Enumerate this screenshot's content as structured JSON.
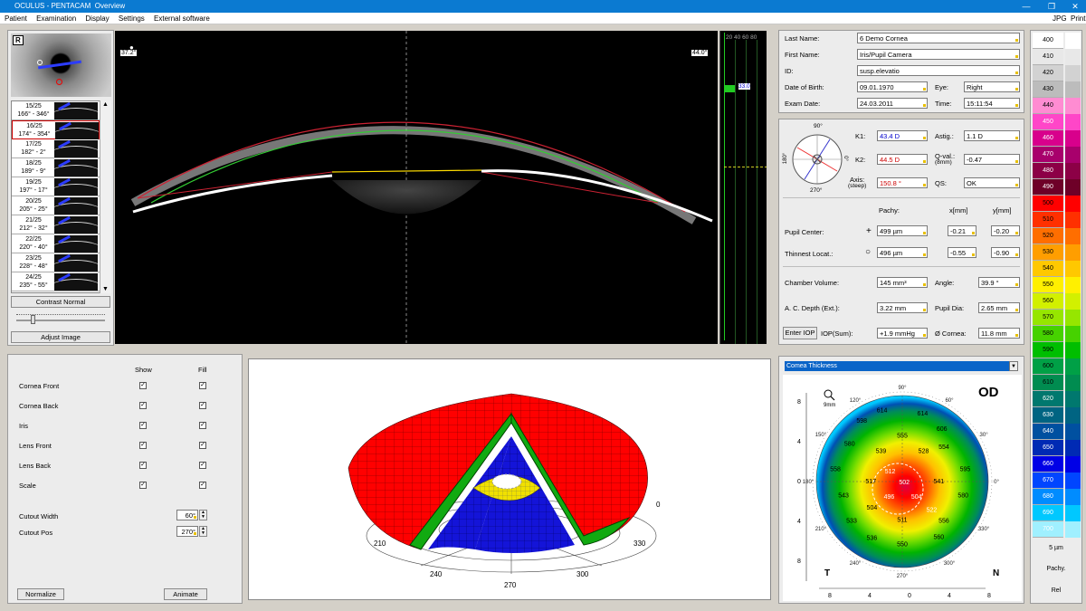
{
  "window": {
    "app": "OCULUS - PENTACAM",
    "view": "Overview"
  },
  "menu": [
    "Patient",
    "Examination",
    "Display",
    "Settings",
    "External software"
  ],
  "menu_right": [
    "JPG",
    "Print"
  ],
  "eye_image": {
    "label": "R"
  },
  "scans": [
    {
      "n": "15/25",
      "deg": "166° - 346°"
    },
    {
      "n": "16/25",
      "deg": "174° - 354°"
    },
    {
      "n": "17/25",
      "deg": "182° - 2°"
    },
    {
      "n": "18/25",
      "deg": "189° - 9°"
    },
    {
      "n": "19/25",
      "deg": "197° - 17°"
    },
    {
      "n": "20/25",
      "deg": "205° - 25°"
    },
    {
      "n": "21/25",
      "deg": "212° - 32°"
    },
    {
      "n": "22/25",
      "deg": "220° - 40°"
    },
    {
      "n": "23/25",
      "deg": "228° - 48°"
    },
    {
      "n": "24/25",
      "deg": "235° - 55°"
    }
  ],
  "scan_controls": {
    "contrast": "Contrast Normal",
    "adjust": "Adjust Image"
  },
  "scheimpflug": {
    "angle_left": "37.2°",
    "angle_right": "44.0°",
    "densito_ticks": "20 40 60 80",
    "densito_value": "33.0"
  },
  "patient": {
    "last_name_label": "Last Name:",
    "last_name": "6 Demo Cornea",
    "first_name_label": "First Name:",
    "first_name": "Iris/Pupil Camera",
    "id_label": "ID:",
    "id": "susp.elevatio",
    "dob_label": "Date of Birth:",
    "dob": "09.01.1970",
    "eye_label": "Eye:",
    "eye": "Right",
    "exam_label": "Exam Date:",
    "exam": "24.03.2011",
    "time_label": "Time:",
    "time": "15:11:54"
  },
  "kerato": {
    "k1_label": "K1:",
    "k1": "43.4 D",
    "k2_label": "K2:",
    "k2": "44.5 D",
    "axis_label": "Axis:",
    "axis_sub": "(steep)",
    "axis": "150.8 °",
    "astig_label": "Astig.:",
    "astig": "1.1 D",
    "qval_label": "Q-val.:",
    "qval_sub": "(8mm)",
    "qval": "-0.47",
    "qs_label": "QS:",
    "qs": "OK",
    "dial_top": "90°",
    "dial_bottom": "270°",
    "dial_left": "180°",
    "dial_right": "0°"
  },
  "measure": {
    "pachy_hdr": "Pachy:",
    "x_hdr": "x[mm]",
    "y_hdr": "y[mm]",
    "pupil_label": "Pupil Center:",
    "pupil_pachy": "499 µm",
    "pupil_x": "-0.21",
    "pupil_y": "-0.20",
    "thin_label": "Thinnest Locat.:",
    "thin_pachy": "496 µm",
    "thin_x": "-0.55",
    "thin_y": "-0.90",
    "cv_label": "Chamber Volume:",
    "cv": "145 mm³",
    "angle_label": "Angle:",
    "angle": "39.9 °",
    "acd_label": "A. C. Depth (Ext.):",
    "acd": "3.22 mm",
    "pd_label": "Pupil Dia:",
    "pd": "2.65 mm",
    "iop_btn": "Enter IOP",
    "iop_label": "IOP(Sum):",
    "iop": "+1.9 mmHg",
    "cornea_label": "Ø Cornea:",
    "cornea": "11.8 mm"
  },
  "display_opts": {
    "show_hdr": "Show",
    "fill_hdr": "Fill",
    "rows": [
      "Cornea Front",
      "Cornea Back",
      "Iris",
      "Lens Front",
      "Lens Back",
      "Scale"
    ],
    "cutout_width_label": "Cutout Width",
    "cutout_width": "60°",
    "cutout_pos_label": "Cutout Pos",
    "cutout_pos": "270°",
    "normalize": "Normalize",
    "animate": "Animate"
  },
  "model3d": {
    "angle_labels": [
      "0",
      "330",
      "300",
      "270",
      "240",
      "210"
    ]
  },
  "map": {
    "dropdown": "Comea Thickness",
    "eye": "OD",
    "temporal": "T",
    "nasal": "N",
    "zoom_label": "9mm",
    "axis_ticks": [
      "8",
      "4",
      "0",
      "4",
      "8"
    ],
    "ring_labels": [
      "90°",
      "120°",
      "150°",
      "180°",
      "210°",
      "240°",
      "270°",
      "300°",
      "330°",
      "0°",
      "30°",
      "60°"
    ],
    "values": [
      {
        "v": "614",
        "x": -2,
        "y": -7
      },
      {
        "v": "614",
        "x": 2,
        "y": -6.7
      },
      {
        "v": "598",
        "x": -4,
        "y": -6
      },
      {
        "v": "555",
        "x": 0,
        "y": -4.5
      },
      {
        "v": "606",
        "x": 3.9,
        "y": -5.2
      },
      {
        "v": "580",
        "x": -5.2,
        "y": -3.7
      },
      {
        "v": "539",
        "x": -2.1,
        "y": -3
      },
      {
        "v": "528",
        "x": 2.1,
        "y": -3
      },
      {
        "v": "554",
        "x": 4.1,
        "y": -3.4
      },
      {
        "v": "558",
        "x": -6.6,
        "y": -1.2
      },
      {
        "v": "517",
        "x": -3.1,
        "y": 0
      },
      {
        "v": "512",
        "x": -1.2,
        "y": -1
      },
      {
        "v": "541",
        "x": 3.6,
        "y": 0
      },
      {
        "v": "595",
        "x": 6.2,
        "y": -1.2
      },
      {
        "v": "543",
        "x": -5.8,
        "y": 1.4
      },
      {
        "v": "502",
        "x": 0.2,
        "y": 0.1
      },
      {
        "v": "496",
        "x": -1.3,
        "y": 1.5
      },
      {
        "v": "504",
        "x": 1.4,
        "y": 1.5
      },
      {
        "v": "580",
        "x": 6,
        "y": 1.4
      },
      {
        "v": "504",
        "x": -3,
        "y": 2.6
      },
      {
        "v": "511",
        "x": 0,
        "y": 3.8
      },
      {
        "v": "522",
        "x": 2.9,
        "y": 2.8
      },
      {
        "v": "533",
        "x": -5,
        "y": 3.9
      },
      {
        "v": "556",
        "x": 4.1,
        "y": 3.9
      },
      {
        "v": "536",
        "x": -3,
        "y": 5.6
      },
      {
        "v": "550",
        "x": 0,
        "y": 6.2
      },
      {
        "v": "560",
        "x": 3.6,
        "y": 5.5
      }
    ]
  },
  "scale": {
    "values": [
      "400",
      "410",
      "420",
      "430",
      "440",
      "450",
      "460",
      "470",
      "480",
      "490",
      "500",
      "510",
      "520",
      "530",
      "540",
      "550",
      "560",
      "570",
      "580",
      "590",
      "600",
      "610",
      "620",
      "630",
      "640",
      "650",
      "660",
      "670",
      "680",
      "690",
      "700"
    ],
    "colors": [
      "#ffffff",
      "#e8e8e8",
      "#d2d2d2",
      "#bcbcbc",
      "#ff8cd2",
      "#ff46c8",
      "#d8008c",
      "#a8006c",
      "#8c0046",
      "#6e0028",
      "#ff0000",
      "#ff3000",
      "#ff6e00",
      "#ff9e00",
      "#ffc800",
      "#fff000",
      "#d2f000",
      "#96e600",
      "#46d200",
      "#00be00",
      "#00a046",
      "#008c50",
      "#00786e",
      "#006482",
      "#0050a0",
      "#002ab4",
      "#0000e6",
      "#0046ff",
      "#008cff",
      "#00c8ff",
      "#a0f0ff"
    ],
    "step": "5 µm",
    "mode": "Pachy.",
    "rel": "Rel"
  }
}
